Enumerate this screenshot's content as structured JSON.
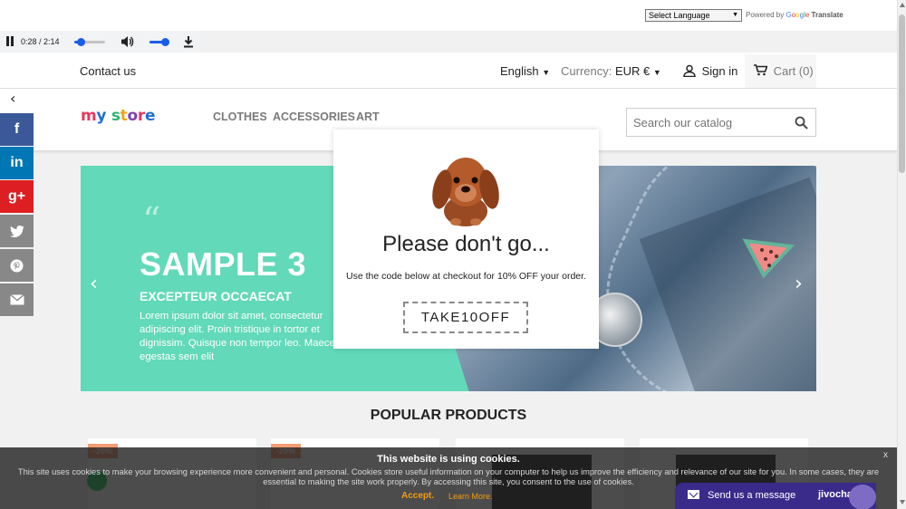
{
  "translate": {
    "select_value": "Select Language",
    "powered_by": "Powered by",
    "google": [
      "G",
      "o",
      "o",
      "g",
      "l",
      "e"
    ],
    "translate_label": "Translate"
  },
  "audio": {
    "time": "0:28 / 2:14",
    "progress": 0.21,
    "volume": 0.8
  },
  "nav": {
    "contact": "Contact us",
    "language": "English",
    "currency_label": "Currency:",
    "currency_value": "EUR €",
    "sign_in": "Sign in",
    "cart": "Cart (0)"
  },
  "header": {
    "logo_parts": [
      {
        "text": "m",
        "color": "#e8365d"
      },
      {
        "text": "y",
        "color": "#1f6fd1"
      },
      {
        "text": " ",
        "color": "#000"
      },
      {
        "text": "s",
        "color": "#2bb673"
      },
      {
        "text": "t",
        "color": "#f4a21b"
      },
      {
        "text": "o",
        "color": "#7b3fb5"
      },
      {
        "text": "r",
        "color": "#e8365d"
      },
      {
        "text": "e",
        "color": "#1f6fd1"
      }
    ],
    "menu": [
      "CLOTHES",
      "ACCESSORIES",
      "ART"
    ],
    "search_placeholder": "Search our catalog"
  },
  "social": [
    {
      "icon": "facebook-icon",
      "glyph": "f",
      "color": "#3b5998"
    },
    {
      "icon": "linkedin-icon",
      "glyph": "in",
      "color": "#0077b5"
    },
    {
      "icon": "google-plus-icon",
      "glyph": "g+",
      "color": "#dd1f23"
    },
    {
      "icon": "twitter-icon",
      "glyph": "🐦",
      "color": "#888888"
    },
    {
      "icon": "pinterest-icon",
      "glyph": "℗",
      "color": "#888888"
    },
    {
      "icon": "email-icon",
      "glyph": "✉",
      "color": "#888888"
    }
  ],
  "slider": {
    "title": "SAMPLE 3",
    "subtitle": "EXCEPTEUR OCCAECAT",
    "lines": [
      "Lorem ipsum dolor sit amet, consectetur",
      "adipiscing elit. Proin tristique in tortor et",
      "dignissim. Quisque non tempor leo. Maecenas",
      "egestas sem elit"
    ]
  },
  "popup": {
    "title": "Please don't go...",
    "text": "Use the code below at checkout for 10% OFF your order.",
    "code": "TAKE10OFF"
  },
  "popular": {
    "title": "POPULAR PRODUCTS",
    "badges": [
      "-20%",
      "-20%",
      "",
      ""
    ]
  },
  "cookie": {
    "title": "This website is using cookies.",
    "text": "This site uses cookies to make your browsing experience more convenient and personal. Cookies store useful information on your computer to help us improve the efficiency and relevance of our site for you. In some cases, they are essential to making the site work properly. By accessing this site, you consent to the use of cookies.",
    "accept": "Accept.",
    "learn_more": "Learn More.",
    "close": "x"
  },
  "chat": {
    "label": "Send us a message",
    "brand": "jivochat"
  },
  "colors": {
    "slider_bg": "#62d9b8",
    "accent_orange": "#f39d12",
    "jivo_purple": "#3a2a8a"
  }
}
